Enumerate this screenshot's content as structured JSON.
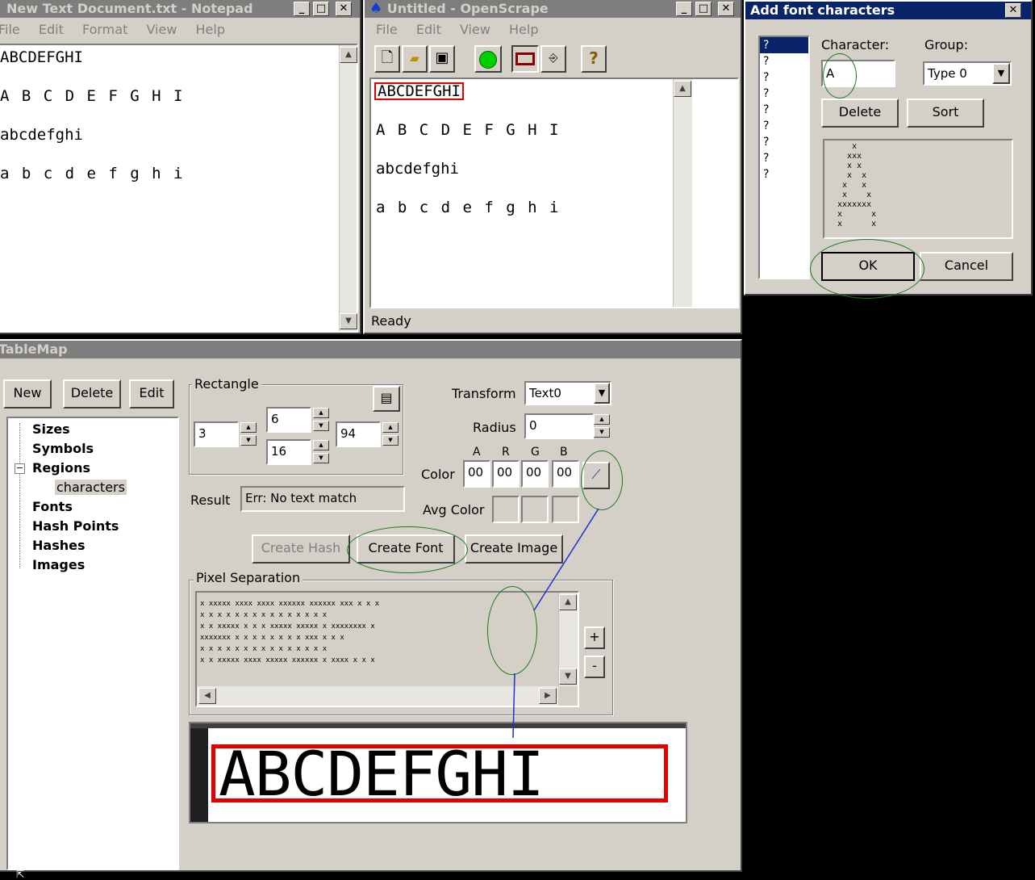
{
  "notepad": {
    "title": "New Text Document.txt - Notepad",
    "menu": [
      "File",
      "Edit",
      "Format",
      "View",
      "Help"
    ],
    "lines": [
      "ABCDEFGHI",
      "A B C D E F G H I",
      "abcdefghi",
      "a b c d e f g h i"
    ]
  },
  "openscrape": {
    "title": "Untitled - OpenScrape",
    "menu": [
      "File",
      "Edit",
      "View",
      "Help"
    ],
    "lines": [
      "ABCDEFGHI",
      "A B C D E F G H I",
      "abcdefghi",
      "a b c d e f g h i"
    ],
    "status": "Ready"
  },
  "dialog": {
    "title": "Add font characters",
    "list_items": [
      "?",
      "?",
      "?",
      "?",
      "?",
      "?",
      "?",
      "?",
      "?"
    ],
    "character_label": "Character:",
    "character_value": "A",
    "group_label": "Group:",
    "group_value": "Type 0",
    "delete_label": "Delete",
    "sort_label": "Sort",
    "ok_label": "OK",
    "cancel_label": "Cancel",
    "preview_rows": [
      "    x",
      "   xxx",
      "   x x",
      "   x  x",
      "  x   x",
      "  x    x",
      " xxxxxxx",
      " x      x",
      " x      x"
    ]
  },
  "tablemap": {
    "title": "TableMap",
    "new_label": "New",
    "delete_label": "Delete",
    "edit_label": "Edit",
    "tree": {
      "sizes": "Sizes",
      "symbols": "Symbols",
      "regions": "Regions",
      "characters": "characters",
      "fonts": "Fonts",
      "hash_points": "Hash Points",
      "hashes": "Hashes",
      "images": "Images"
    },
    "rectangle_label": "Rectangle",
    "rect_left": "3",
    "rect_top": "6",
    "rect_bottom": "16",
    "rect_right": "94",
    "transform_label": "Transform",
    "transform_value": "Text0",
    "radius_label": "Radius",
    "radius_value": "0",
    "color_label": "Color",
    "color_headers": [
      "A",
      "R",
      "G",
      "B"
    ],
    "color_values": [
      "00",
      "00",
      "00",
      "00"
    ],
    "avg_color_label": "Avg Color",
    "result_label": "Result",
    "result_value": "Err: No text match",
    "create_hash_label": "Create Hash",
    "create_font_label": "Create Font",
    "create_image_label": "Create Image",
    "pixel_sep_label": "Pixel Separation",
    "plus_label": "+",
    "minus_label": "-",
    "preview_text": "ABCDEFGHI"
  },
  "colors": {
    "highlight_red": "#e00000",
    "annotation_green": "#1a7a1a",
    "annotation_blue": "#1f2fd0",
    "active_title": "#0a246a"
  }
}
